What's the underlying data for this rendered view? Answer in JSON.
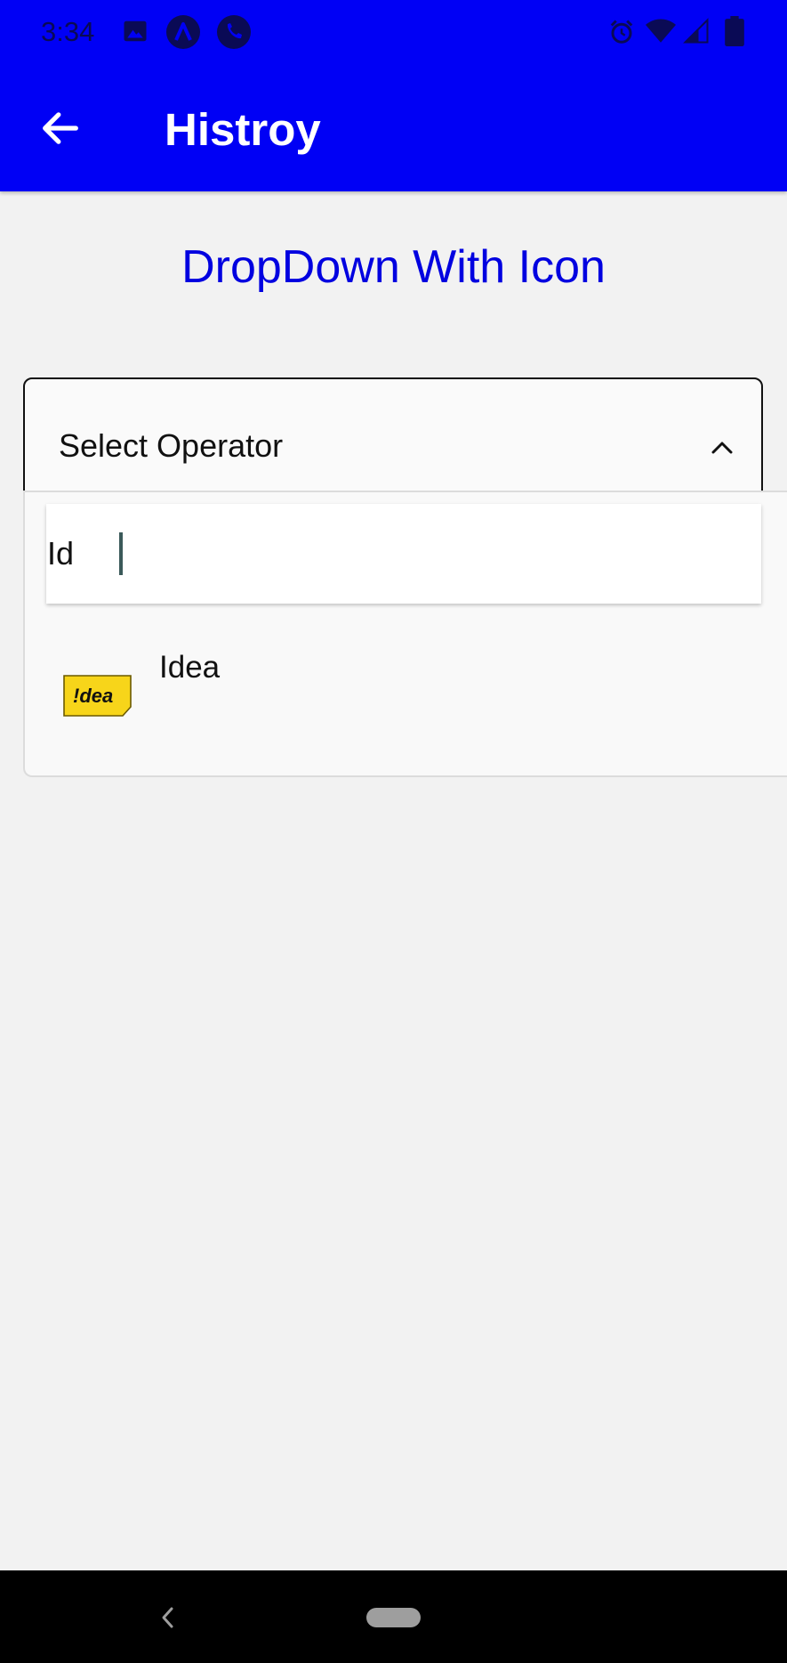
{
  "status_bar": {
    "time": "3:34",
    "left_icons": [
      "image-icon",
      "app-a-icon",
      "phone-icon"
    ],
    "right_icons": [
      "alarm-icon",
      "wifi-icon",
      "signal-icon",
      "battery-icon"
    ]
  },
  "toolbar": {
    "title": "Histroy",
    "back_icon": "arrow-left-icon"
  },
  "page": {
    "heading": "DropDown With Icon"
  },
  "dropdown": {
    "label": "Select Operator",
    "expanded": true,
    "search_value": "Id",
    "options": [
      {
        "label": "Idea",
        "logo_text": "!dea"
      }
    ]
  },
  "colors": {
    "accent": "#0000f5",
    "heading": "#0000e0",
    "idea_yellow": "#f7d51a"
  },
  "nav_bar": {
    "icons": [
      "nav-back-icon",
      "nav-home-pill"
    ]
  }
}
